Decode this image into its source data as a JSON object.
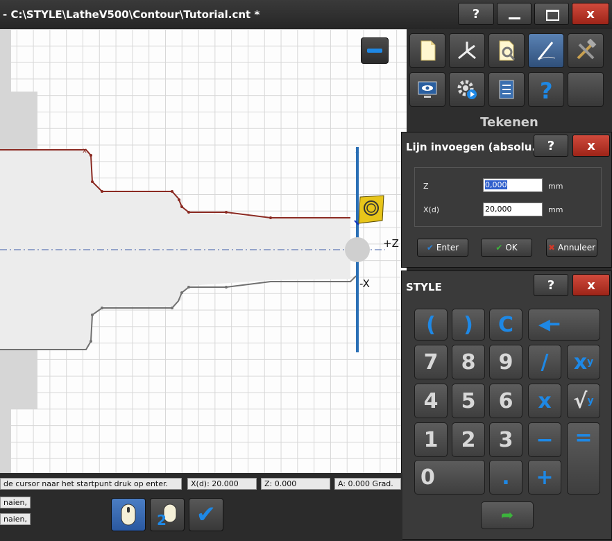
{
  "window": {
    "title": "- C:\\STYLE\\LatheV500\\Contour\\Tutorial.cnt *",
    "help": "?",
    "close": "x"
  },
  "canvas": {
    "plus_z": "+Z",
    "minus_x": "-X"
  },
  "toolbar": {
    "section_label": "Tekenen",
    "tools": [
      "new-document",
      "lathe",
      "document-settings",
      "draw",
      "tools",
      "view",
      "simulate",
      "list",
      "help",
      "empty"
    ],
    "active_tool": "draw"
  },
  "line_dialog": {
    "title": "Lijn invoegen (absolu...",
    "help": "?",
    "close": "x",
    "z_label": "Z",
    "z_value": "0,000",
    "z_unit": "mm",
    "x_label": "X(d)",
    "x_value": "20,000",
    "x_unit": "mm",
    "enter_label": "Enter",
    "ok_label": "OK",
    "cancel_label": "Annuleer"
  },
  "keypad": {
    "title": "STYLE",
    "help": "?",
    "close": "x",
    "keys": [
      "(",
      ")",
      "C",
      "7",
      "8",
      "9",
      "/",
      "x",
      "4",
      "5",
      "6",
      "x",
      "√",
      "1",
      "2",
      "3",
      "−",
      "=",
      "0",
      ".",
      "+"
    ]
  },
  "status": {
    "message": "de cursor naar het startpunt druk op enter.",
    "xd": "X(d): 20.000",
    "z": "Z: 0.000",
    "a": "A: 0.000 Grad.",
    "left1": "naien, R:",
    "left2": "naien, R:"
  },
  "colors": {
    "contour_top": "#8b2a22",
    "contour_bottom": "#707070",
    "accent_blue": "#1e88e5",
    "close_red": "#b8352a"
  }
}
